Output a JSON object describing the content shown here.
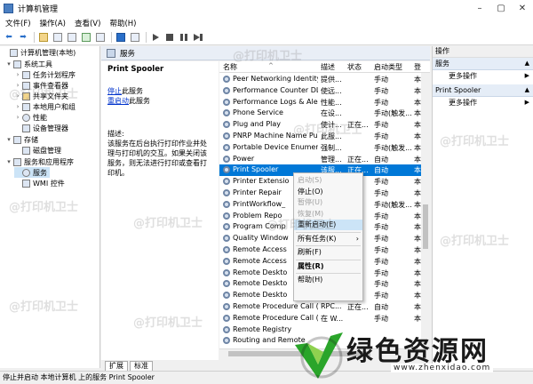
{
  "window": {
    "title": "计算机管理"
  },
  "menu": [
    "文件(F)",
    "操作(A)",
    "查看(V)",
    "帮助(H)"
  ],
  "tree": [
    {
      "label": "计算机管理(本地)",
      "level": 0,
      "exp": ""
    },
    {
      "label": "系统工具",
      "level": 1,
      "exp": "▾"
    },
    {
      "label": "任务计划程序",
      "level": 2,
      "exp": "›"
    },
    {
      "label": "事件查看器",
      "level": 2,
      "exp": "›"
    },
    {
      "label": "共享文件夹",
      "level": 2,
      "exp": "›"
    },
    {
      "label": "本地用户和组",
      "level": 2,
      "exp": "›"
    },
    {
      "label": "性能",
      "level": 2,
      "exp": "›"
    },
    {
      "label": "设备管理器",
      "level": 2,
      "exp": ""
    },
    {
      "label": "存储",
      "level": 1,
      "exp": "▾"
    },
    {
      "label": "磁盘管理",
      "level": 2,
      "exp": ""
    },
    {
      "label": "服务和应用程序",
      "level": 1,
      "exp": "▾"
    },
    {
      "label": "服务",
      "level": 2,
      "exp": ""
    },
    {
      "label": "WMI 控件",
      "level": 2,
      "exp": ""
    }
  ],
  "content_header": "服务",
  "description": {
    "service_title": "Print Spooler",
    "stop_link": "停止",
    "stop_suffix": "此服务",
    "restart_link": "重启动",
    "restart_suffix": "此服务",
    "desc_label": "描述:",
    "desc_body": "该服务在后台执行打印作业并处理与打印机的交互。如果关闭该服务，则无法进行打印或查看打印机。"
  },
  "columns": {
    "name": "名称",
    "desc": "描述",
    "status": "状态",
    "startup": "启动类型",
    "logon": "登"
  },
  "services": [
    {
      "name": "Peer Networking Identity...",
      "desc": "提供...",
      "status": "",
      "startup": "手动",
      "logon": "本"
    },
    {
      "name": "Performance Counter DL...",
      "desc": "使远...",
      "status": "",
      "startup": "手动",
      "logon": "本"
    },
    {
      "name": "Performance Logs & Aler...",
      "desc": "性能...",
      "status": "",
      "startup": "手动",
      "logon": "本"
    },
    {
      "name": "Phone Service",
      "desc": "在设...",
      "status": "",
      "startup": "手动(触发...",
      "logon": "本"
    },
    {
      "name": "Plug and Play",
      "desc": "使计...",
      "status": "正在...",
      "startup": "手动",
      "logon": "本"
    },
    {
      "name": "PNRP Machine Name Pu...",
      "desc": "此服...",
      "status": "",
      "startup": "手动",
      "logon": "本"
    },
    {
      "name": "Portable Device Enumera...",
      "desc": "强制...",
      "status": "",
      "startup": "手动(触发...",
      "logon": "本"
    },
    {
      "name": "Power",
      "desc": "管理...",
      "status": "正在...",
      "startup": "自动",
      "logon": "本"
    },
    {
      "name": "Print Spooler",
      "desc": "该服...",
      "status": "正在...",
      "startup": "自动",
      "logon": "本"
    },
    {
      "name": "Printer Extensio",
      "desc": "",
      "status": "",
      "startup": "手动",
      "logon": "本"
    },
    {
      "name": "Printer Repair",
      "desc": "",
      "status": "",
      "startup": "手动",
      "logon": "本"
    },
    {
      "name": "PrintWorkflow_",
      "desc": "",
      "status": "",
      "startup": "手动(触发...",
      "logon": "本"
    },
    {
      "name": "Problem Repo",
      "desc": "",
      "status": "",
      "startup": "手动",
      "logon": "本"
    },
    {
      "name": "Program Comp",
      "desc": "",
      "status": "",
      "startup": "手动",
      "logon": "本"
    },
    {
      "name": "Quality Window",
      "desc": "",
      "status": "",
      "startup": "手动",
      "logon": "本"
    },
    {
      "name": "Remote Access",
      "desc": "",
      "status": "",
      "startup": "手动",
      "logon": "本"
    },
    {
      "name": "Remote Access",
      "desc": "",
      "status": "",
      "startup": "手动",
      "logon": "本"
    },
    {
      "name": "Remote Deskto",
      "desc": "",
      "status": "",
      "startup": "手动",
      "logon": "本"
    },
    {
      "name": "Remote Deskto",
      "desc": "",
      "status": "",
      "startup": "手动",
      "logon": "本"
    },
    {
      "name": "Remote Deskto",
      "desc": "",
      "status": "",
      "startup": "手动",
      "logon": "本"
    },
    {
      "name": "Remote Procedure Call (...",
      "desc": "RPC...",
      "status": "正在...",
      "startup": "自动",
      "logon": "本"
    },
    {
      "name": "Remote Procedure Call (...",
      "desc": "在 W...",
      "status": "",
      "startup": "手动",
      "logon": "本"
    },
    {
      "name": "Remote Registry",
      "desc": "",
      "status": "",
      "startup": "",
      "logon": ""
    },
    {
      "name": "Routing and Remote",
      "desc": "",
      "status": "",
      "startup": "",
      "logon": ""
    }
  ],
  "context_menu": [
    {
      "label": "启动(S)",
      "disabled": true
    },
    {
      "label": "停止(O)",
      "disabled": false
    },
    {
      "label": "暂停(U)",
      "disabled": true
    },
    {
      "label": "恢复(M)",
      "disabled": true
    },
    {
      "label": "重新启动(E)",
      "disabled": false,
      "highlight": true
    },
    {
      "sep": true
    },
    {
      "label": "所有任务(K)",
      "disabled": false,
      "submenu": true
    },
    {
      "sep": true
    },
    {
      "label": "刷新(F)",
      "disabled": false
    },
    {
      "sep": true
    },
    {
      "label": "属性(R)",
      "disabled": false,
      "bold": true
    },
    {
      "sep": true
    },
    {
      "label": "帮助(H)",
      "disabled": false
    }
  ],
  "actions": {
    "header": "操作",
    "sections": [
      {
        "title": "服务",
        "items": [
          "更多操作"
        ]
      },
      {
        "title": "Print Spooler",
        "items": [
          "更多操作"
        ]
      }
    ]
  },
  "tabs": [
    "扩展",
    "标准"
  ],
  "status": "停止并启动 本地计算机 上的服务 Print Spooler",
  "watermark": "@打印机卫士",
  "logo": {
    "text": "绿色资源网",
    "sub": "www.zhenxidao.com"
  }
}
